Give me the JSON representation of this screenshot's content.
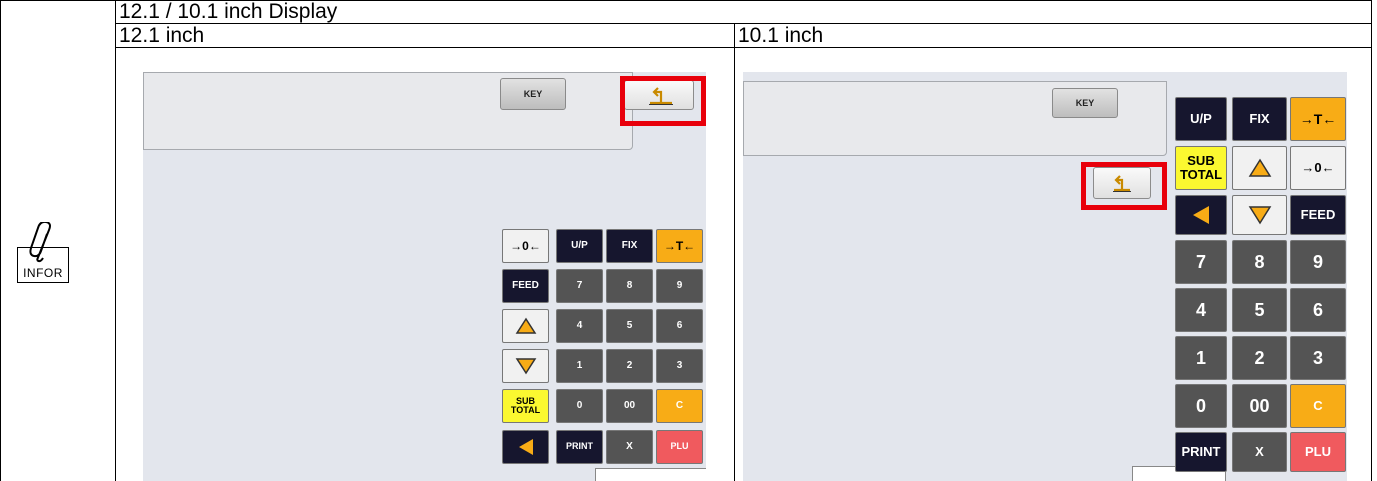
{
  "doc": {
    "title": "12.1 / 10.1 inch Display",
    "col_left": "12.1 inch",
    "col_right": "10.1 inch",
    "infor_label": "INFOR"
  },
  "screen_12": {
    "key_label": "KEY",
    "keys": [
      [
        "→0←",
        "U/P",
        "FIX",
        "→T←"
      ],
      [
        "FEED",
        "7",
        "8",
        "9"
      ],
      [
        "△",
        "4",
        "5",
        "6"
      ],
      [
        "▽",
        "1",
        "2",
        "3"
      ],
      [
        "SUB TOTAL",
        "0",
        "00",
        "C"
      ],
      [
        "◀",
        "PRINT",
        "X",
        "PLU"
      ]
    ]
  },
  "screen_10": {
    "key_label": "KEY",
    "keys": [
      [
        "U/P",
        "FIX",
        "→T←"
      ],
      [
        "SUB TOTAL",
        "△",
        "→0←"
      ],
      [
        "◀",
        "▽",
        "FEED"
      ],
      [
        "7",
        "8",
        "9"
      ],
      [
        "4",
        "5",
        "6"
      ],
      [
        "1",
        "2",
        "3"
      ],
      [
        "0",
        "00",
        "C"
      ],
      [
        "PRINT",
        "X",
        "PLU"
      ]
    ]
  },
  "colors": {
    "highlight": "#e8000b",
    "navy": "#16162e",
    "gray": "#545454",
    "yellow": "#fbf830",
    "orange": "#f8ac16",
    "red": "#f05a5e"
  },
  "icons": {
    "return": "return-arrow-icon",
    "up": "up-triangle-icon",
    "down": "down-triangle-icon",
    "left": "left-triangle-icon",
    "clip": "paperclip-icon"
  }
}
